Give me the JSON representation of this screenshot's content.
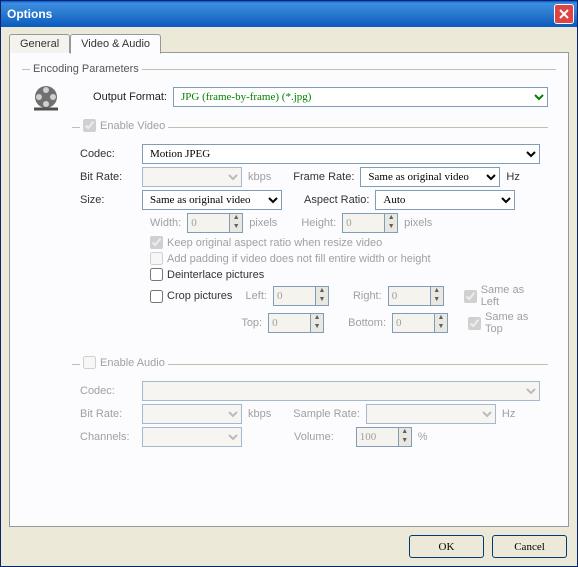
{
  "window": {
    "title": "Options"
  },
  "tabs": [
    {
      "label": "General"
    },
    {
      "label": "Video & Audio"
    }
  ],
  "encoding": {
    "legend": "Encoding Parameters",
    "output_format_label": "Output Format:",
    "output_format_value": "JPG (frame-by-frame) (*.jpg)"
  },
  "video": {
    "legend": "Enable Video",
    "codec_label": "Codec:",
    "codec_value": "Motion JPEG",
    "bitrate_label": "Bit Rate:",
    "bitrate_value": "",
    "bitrate_unit": "kbps",
    "framerate_label": "Frame Rate:",
    "framerate_value": "Same as original video",
    "framerate_unit": "Hz",
    "size_label": "Size:",
    "size_value": "Same as original video",
    "aspect_label": "Aspect Ratio:",
    "aspect_value": "Auto",
    "width_label": "Width:",
    "width_value": "0",
    "height_label": "Height:",
    "height_value": "0",
    "pixels": "pixels",
    "keep_aspect": "Keep original aspect ratio when resize video",
    "add_padding": "Add padding if video does not fill entire width or height",
    "deinterlace": "Deinterlace pictures",
    "crop": "Crop pictures",
    "left_label": "Left:",
    "left_value": "0",
    "right_label": "Right:",
    "right_value": "0",
    "top_label": "Top:",
    "top_value": "0",
    "bottom_label": "Bottom:",
    "bottom_value": "0",
    "same_left": "Same as Left",
    "same_top": "Same as Top"
  },
  "audio": {
    "legend": "Enable Audio",
    "codec_label": "Codec:",
    "codec_value": "",
    "bitrate_label": "Bit Rate:",
    "bitrate_value": "",
    "bitrate_unit": "kbps",
    "samplerate_label": "Sample Rate:",
    "samplerate_value": "",
    "samplerate_unit": "Hz",
    "channels_label": "Channels:",
    "channels_value": "",
    "volume_label": "Volume:",
    "volume_value": "100",
    "volume_unit": "%"
  },
  "buttons": {
    "ok": "OK",
    "cancel": "Cancel"
  }
}
